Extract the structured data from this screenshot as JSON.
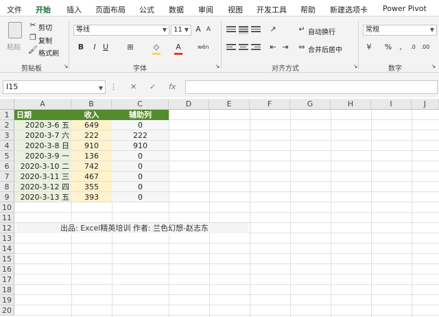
{
  "tabs": [
    "文件",
    "开始",
    "插入",
    "页面布局",
    "公式",
    "数据",
    "审阅",
    "视图",
    "开发工具",
    "帮助",
    "新建选项卡",
    "Power Pivot"
  ],
  "clipboard": {
    "paste": "粘贴",
    "cut": "剪切",
    "copy": "复制",
    "format_painter": "格式刷",
    "label": "剪贴板"
  },
  "font": {
    "name": "等线",
    "size": "11",
    "bold": "B",
    "italic": "I",
    "underline": "U",
    "label": "字体"
  },
  "alignment": {
    "wrap": "自动换行",
    "merge": "合并后居中",
    "label": "对齐方式"
  },
  "number": {
    "format": "常规",
    "label": "数字"
  },
  "formula_bar": {
    "name_box": "I15",
    "fx": "fx"
  },
  "columns": [
    "A",
    "B",
    "C",
    "D",
    "E",
    "F",
    "G",
    "H",
    "I",
    "J"
  ],
  "rows": [
    "1",
    "2",
    "3",
    "4",
    "5",
    "6",
    "7",
    "8",
    "9",
    "10",
    "11",
    "12",
    "13",
    "14",
    "15",
    "16",
    "17",
    "18",
    "19",
    "20"
  ],
  "sheet": {
    "headers": [
      "日期",
      "收入",
      "辅助列"
    ],
    "data": [
      {
        "date": "2020-3-6 五",
        "income": "649",
        "helper": "0"
      },
      {
        "date": "2020-3-7 六",
        "income": "222",
        "helper": "222"
      },
      {
        "date": "2020-3-8 日",
        "income": "910",
        "helper": "910"
      },
      {
        "date": "2020-3-9 一",
        "income": "136",
        "helper": "0"
      },
      {
        "date": "2020-3-10 二",
        "income": "742",
        "helper": "0"
      },
      {
        "date": "2020-3-11 三",
        "income": "467",
        "helper": "0"
      },
      {
        "date": "2020-3-12 四",
        "income": "355",
        "helper": "0"
      },
      {
        "date": "2020-3-13 五",
        "income": "393",
        "helper": "0"
      }
    ],
    "note": "出品: Excel精英培训 作者: 兰色幻想-赵志东"
  },
  "colors": {
    "accent": "#217346",
    "header_fill": "#558b2f",
    "date_fill": "#ebf1de",
    "income_fill": "#fff2cc"
  }
}
